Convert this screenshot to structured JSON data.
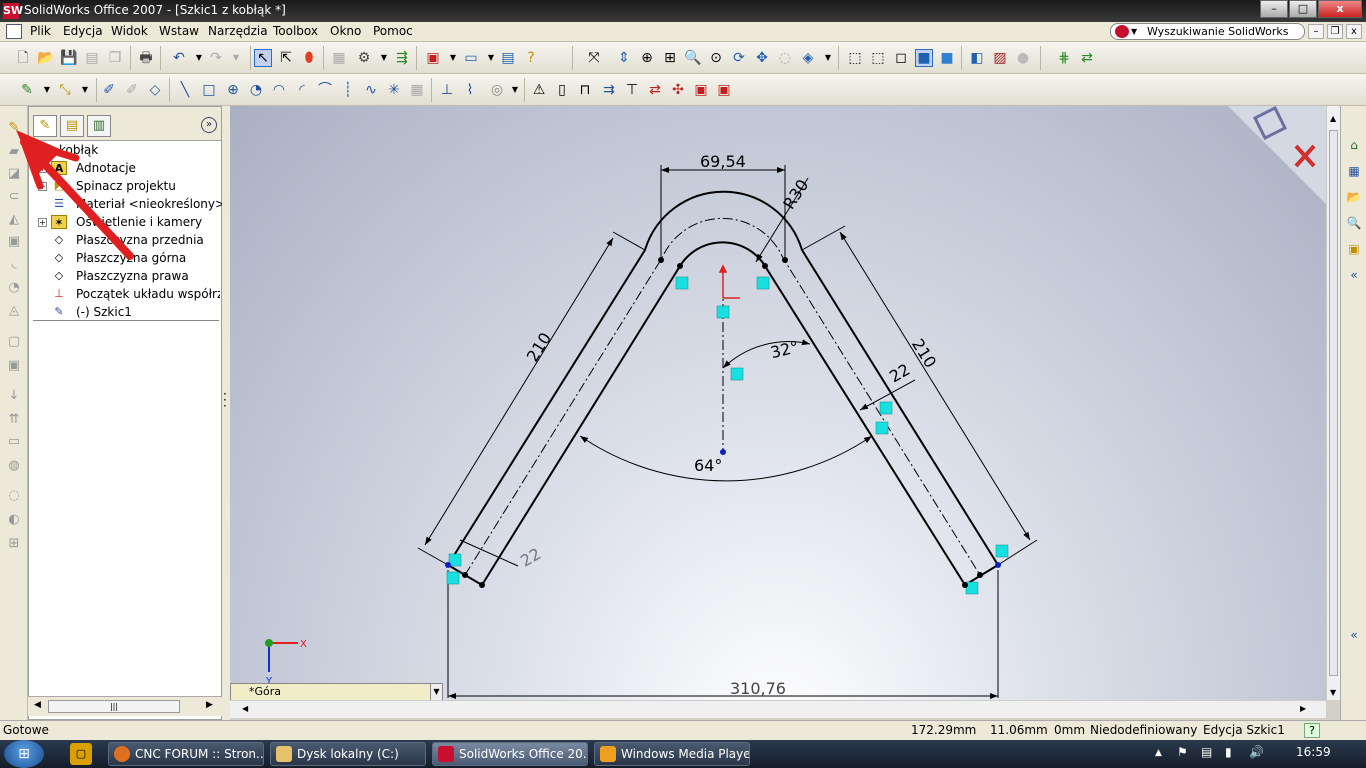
{
  "window": {
    "title": "SolidWorks Office 2007 - [Szkic1 z kobłąk *]",
    "app_icon": "SW",
    "min": "–",
    "max": "□",
    "close": "x"
  },
  "menu": {
    "items": [
      "Plik",
      "Edycja",
      "Widok",
      "Wstaw",
      "Narzędzia",
      "Toolbox",
      "Okno",
      "Pomoc"
    ],
    "search_label": "Wyszukiwanie SolidWorks",
    "mdi": [
      "–",
      "❐",
      "x"
    ]
  },
  "feature_manager": {
    "tabs": [
      "feature-manager-tab",
      "property-manager-tab",
      "configuration-manager-tab"
    ],
    "more": "»",
    "root": "kobłąk",
    "items": [
      {
        "label": "Adnotacje",
        "icon": "annotation-icon",
        "expand": "+"
      },
      {
        "label": "Spinacz projektu",
        "icon": "design-binder-icon",
        "expand": "+"
      },
      {
        "label": "Materiał <nieokreślony>",
        "icon": "material-icon",
        "expand": ""
      },
      {
        "label": "Oświetlenie i kamery",
        "icon": "lights-cameras-icon",
        "expand": "+"
      },
      {
        "label": "Płaszczyzna przednia",
        "icon": "plane-icon",
        "expand": ""
      },
      {
        "label": "Płaszczyzna górna",
        "icon": "plane-icon",
        "expand": ""
      },
      {
        "label": "Płaszczyzna prawa",
        "icon": "plane-icon",
        "expand": ""
      },
      {
        "label": "Początek układu współrzędnych",
        "icon": "origin-icon",
        "expand": ""
      },
      {
        "label": "(-) Szkic1",
        "icon": "sketch-icon",
        "expand": ""
      }
    ],
    "hscroll_thumb": "|||"
  },
  "viewport": {
    "view_name": "*Góra",
    "dimensions": {
      "top_width": "69,54",
      "radius": "R30",
      "left_length": "210",
      "right_length": "210",
      "half_angle": "32°",
      "thickness_right": "22",
      "thickness_left": "22",
      "total_angle": "64°",
      "bottom_width": "310,76"
    },
    "axis": {
      "x": "X",
      "y": "Y"
    }
  },
  "status": {
    "text": "Gotowe",
    "x": "172.29mm",
    "y": "11.06mm",
    "z": "0mm",
    "state": "Niedodefiniowany",
    "mode": "Edycja Szkic1",
    "help": "?"
  },
  "taskbar": {
    "apps": [
      {
        "label": "CNC FORUM :: Stron...",
        "color": "#e07020"
      },
      {
        "label": "Dysk lokalny (C:)",
        "color": "#e6c36a"
      },
      {
        "label": "SolidWorks Office 20...",
        "color": "#c8102e"
      },
      {
        "label": "Windows Media Player",
        "color": "#f0a020"
      }
    ],
    "clock": "16:59"
  },
  "colors": {
    "accent_red": "#c8102e",
    "sketch_line": "#000000",
    "relation_icon": "#18e0e0",
    "annotation_arrow": "#e02020"
  }
}
